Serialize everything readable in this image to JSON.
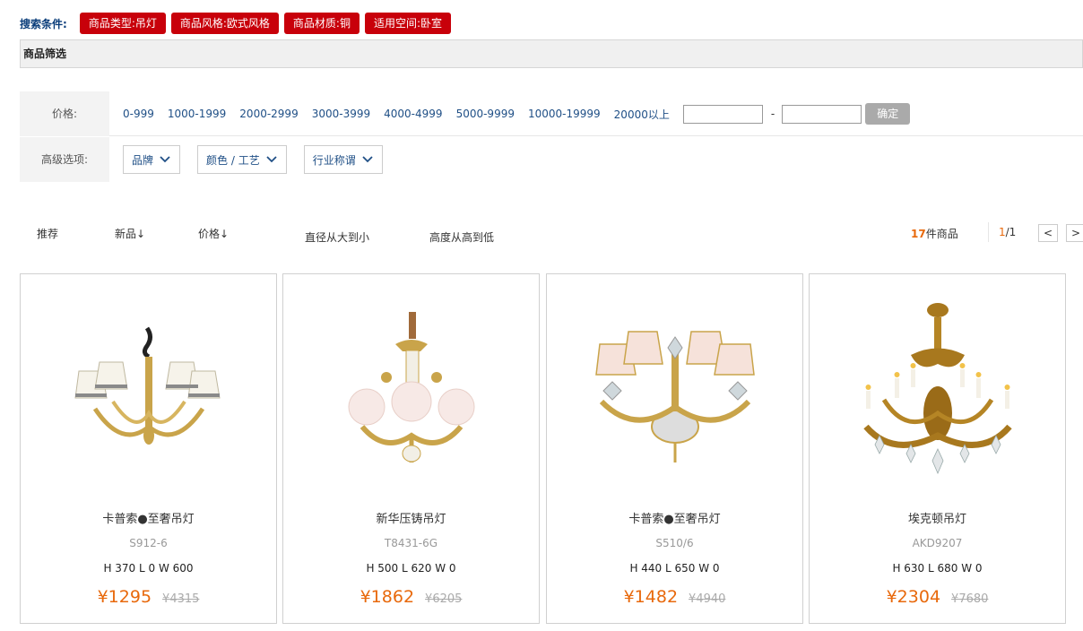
{
  "search": {
    "label": "搜索条件:",
    "tags": [
      "商品类型:吊灯",
      "商品风格:欧式风格",
      "商品材质:铜",
      "适用空间:卧室"
    ]
  },
  "filter": {
    "title": "商品筛选",
    "price_label": "价格:",
    "price_ranges": [
      "0-999",
      "1000-1999",
      "2000-2999",
      "3000-3999",
      "4000-4999",
      "5000-9999",
      "10000-19999",
      "20000以上"
    ],
    "price_min_value": "",
    "price_max_value": "",
    "range_separator": "-",
    "confirm": "确定",
    "advanced_label": "高级选项:",
    "dropdowns": [
      "品牌",
      "颜色 / 工艺",
      "行业称谓"
    ]
  },
  "sort": {
    "recommend": "推荐",
    "newest": "新品↓",
    "price": "价格↓",
    "diameter": "直径从大到小",
    "height": "高度从高到低",
    "count_number": "17",
    "count_suffix": "件商品",
    "page_current": "1",
    "page_total": "/1",
    "prev": "<",
    "next": ">"
  },
  "products": [
    {
      "name": "卡普索●至奢吊灯",
      "model": "S912-6",
      "dims": "H 370 L 0 W 600",
      "price": "¥1295",
      "old_price": "¥4315",
      "icon": "white-shade-chandelier-icon"
    },
    {
      "name": "新华压铸吊灯",
      "model": "T8431-6G",
      "dims": "H 500 L 620 W 0",
      "price": "¥1862",
      "old_price": "¥6205",
      "icon": "glass-globe-chandelier-icon"
    },
    {
      "name": "卡普索●至奢吊灯",
      "model": "S510/6",
      "dims": "H 440 L 650 W 0",
      "price": "¥1482",
      "old_price": "¥4940",
      "icon": "pink-shade-chandelier-icon"
    },
    {
      "name": "埃克顿吊灯",
      "model": "AKD9207",
      "dims": "H 630 L 680 W 0",
      "price": "¥2304",
      "old_price": "¥7680",
      "icon": "crystal-candle-chandelier-icon"
    }
  ],
  "colors": {
    "tag_red": "#c8000a",
    "link_blue": "#1f4f86",
    "price_orange": "#e8690c",
    "label_navy": "#0a3d7a"
  }
}
